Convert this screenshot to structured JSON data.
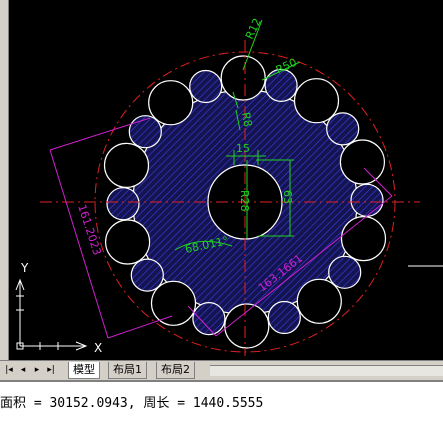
{
  "drawing": {
    "dim_labels": {
      "r12": "R12",
      "r50": "R50",
      "r8": "R8",
      "dim15": "15",
      "r28": "R28",
      "dim63": "63",
      "angle": "68.011°",
      "len_left": "161.2023",
      "len_right": "163.1661"
    },
    "ucs": {
      "y_label": "Y",
      "x_label": "X"
    },
    "colors": {
      "gear_fill": "#141450",
      "hatch": "#3a3ad8",
      "outline": "#ffffff",
      "centerline": "#e02020",
      "dimension_green": "#20d020",
      "dimension_magenta": "#d020d0"
    }
  },
  "layout_tabs": {
    "nav_first": "|◂",
    "nav_prev": "◂",
    "nav_next": "▸",
    "nav_last": "▸|",
    "tabs": [
      "模型",
      "布局1",
      "布局2"
    ],
    "active": "模型"
  },
  "command_line": {
    "text": "面积 = 30152.0943, 周长 = 1440.5555"
  }
}
